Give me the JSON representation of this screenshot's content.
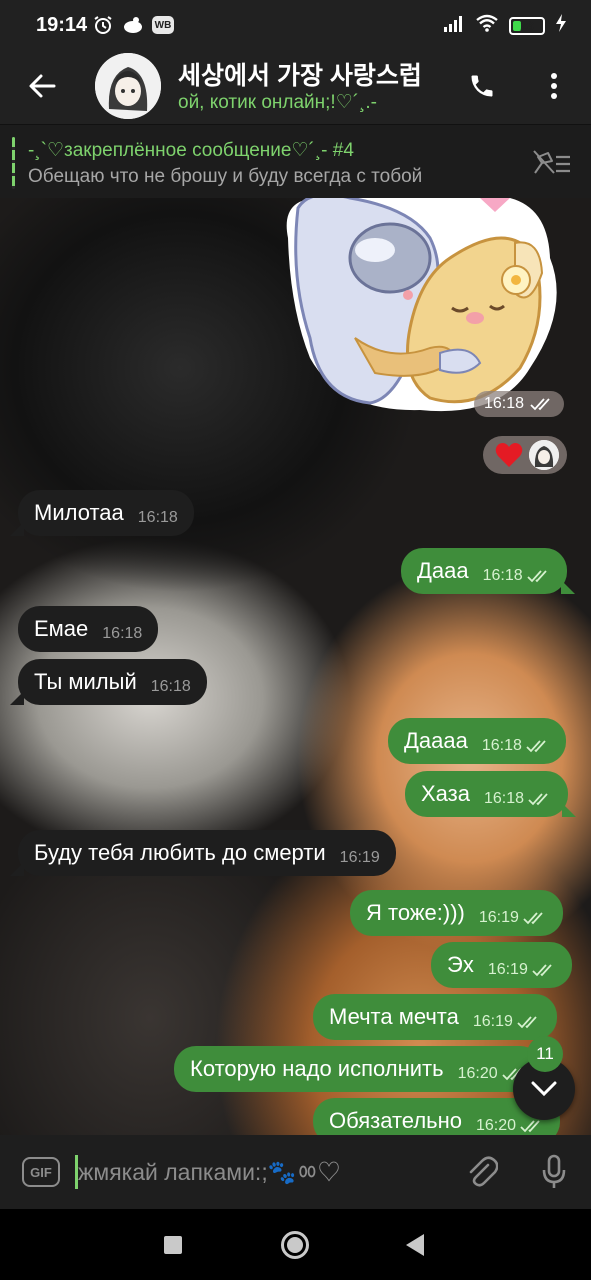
{
  "status_bar": {
    "time": "19:14",
    "battery_level": "28",
    "battery_fraction": 0.28,
    "icons": [
      "alarm-icon",
      "cloud-icon",
      "wb-icon",
      "signal-icon",
      "wifi-icon",
      "battery-icon",
      "charging-icon"
    ],
    "wb_label": "WB"
  },
  "header": {
    "title": "세상에서 가장 사랑스럽",
    "status": "ой, котик онлайн;!♡´¸.-",
    "icons": [
      "back-arrow-icon",
      "phone-icon",
      "more-vert-icon"
    ]
  },
  "pinned": {
    "title": "-¸`♡закреплённое сообщение♡´¸- #4",
    "text": "Обещаю что не брошу и буду всегда с тобой",
    "icon": "unpin-icon"
  },
  "sticker": {
    "time": "16:18"
  },
  "messages": [
    {
      "dir": "in",
      "text": "Милотаа",
      "time": "16:18"
    },
    {
      "dir": "out",
      "text": "Дааа",
      "time": "16:18"
    },
    {
      "dir": "in",
      "text": "Емае",
      "time": "16:18"
    },
    {
      "dir": "in",
      "text": "Ты милый",
      "time": "16:18"
    },
    {
      "dir": "out",
      "text": "Даааа",
      "time": "16:18"
    },
    {
      "dir": "out",
      "text": "Хаза",
      "time": "16:18"
    },
    {
      "dir": "in",
      "text": "Буду тебя любить до смерти",
      "time": "16:19"
    },
    {
      "dir": "out",
      "text": "Я тоже:)))",
      "time": "16:19"
    },
    {
      "dir": "out",
      "text": "Эх",
      "time": "16:19"
    },
    {
      "dir": "out",
      "text": "Мечта мечта",
      "time": "16:19"
    },
    {
      "dir": "out",
      "text": "Которую надо исполнить",
      "time": "16:20"
    },
    {
      "dir": "out",
      "text": "Обязательно",
      "time": "16:20"
    }
  ],
  "unread_count": "11",
  "input": {
    "placeholder": "жмякай лапками:;🐾ㆀ♡",
    "gif_label": "GIF"
  },
  "colors": {
    "accent": "#7ed26d",
    "outgoing_bubble": "#3f8d3b",
    "incoming_bubble": "#1e1e1e",
    "bar_background": "#212121"
  }
}
